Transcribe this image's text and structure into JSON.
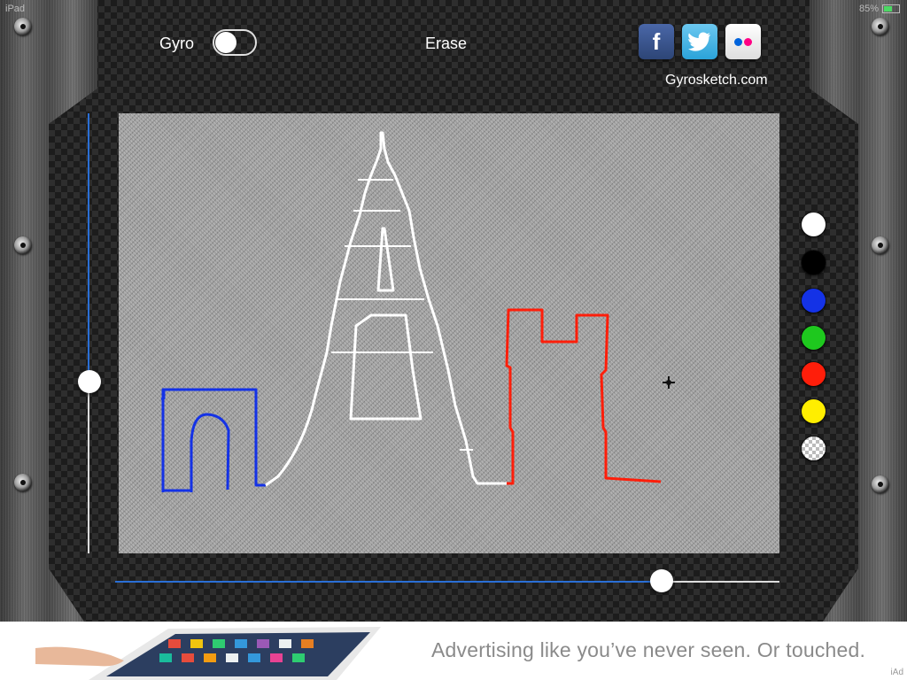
{
  "status_bar": {
    "device": "iPad",
    "battery": "85%"
  },
  "toolbar": {
    "gyro_label": "Gyro",
    "gyro_enabled": false,
    "erase_label": "Erase",
    "website": "Gyrosketch.com"
  },
  "share": [
    {
      "name": "facebook",
      "glyph": "f",
      "color": "#3b5998"
    },
    {
      "name": "twitter",
      "glyph": "bird",
      "color": "#38b0e6"
    },
    {
      "name": "flickr",
      "glyph": "dots",
      "color": "#ff0084"
    }
  ],
  "colors": {
    "palette": [
      "#ffffff",
      "#000000",
      "#1432e6",
      "#1ec81e",
      "#ff1e0a",
      "#ffee00",
      "transparent"
    ],
    "accent": "#2a6fd6"
  },
  "sliders": {
    "vertical_value": 0.61,
    "horizontal_value": 0.82
  },
  "ad": {
    "tagline": "Advertising like you’ve never seen. Or touched.",
    "provider": "iAd"
  }
}
